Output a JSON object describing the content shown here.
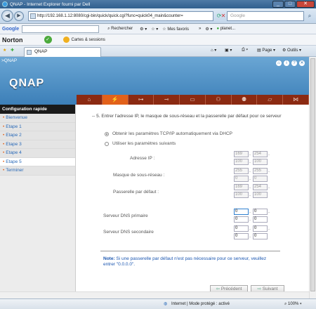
{
  "window": {
    "title": "QNAP - Internet Explorer fourni par Dell"
  },
  "address_bar": {
    "url": "http://192.168.1.12:8080/cgi-bin/quick/quick.cgi?func=quick04_main&counter=",
    "search_placeholder": "Google"
  },
  "google_toolbar": {
    "logo": "Google",
    "search_label": "Rechercher",
    "favorites_label": "Mes favoris",
    "planet_label": "planet..."
  },
  "norton_toolbar": {
    "logo": "Norton",
    "cards_label": "Cartes & sessions"
  },
  "tab_bar": {
    "tab_label": "QNAP",
    "page_label": "Page",
    "tools_label": "Outils"
  },
  "qnap": {
    "breadcrumb": ">QNAP",
    "logo": "QNAP"
  },
  "sidebar": {
    "header": "Configuration rapide",
    "items": [
      {
        "label": "Bienvenue",
        "active": false
      },
      {
        "label": "Etape 1",
        "active": false
      },
      {
        "label": "Etape 2",
        "active": false
      },
      {
        "label": "Etape 3",
        "active": false
      },
      {
        "label": "Etape 4",
        "active": false
      },
      {
        "label": "Etape 5",
        "active": true
      },
      {
        "label": "Terminer",
        "active": false
      }
    ]
  },
  "form": {
    "instruction": "-- 5. Entrer l'adresse IP, le masque de sous-réseau et la passerelle par défaut pour ce serveur",
    "option_dhcp": "Obtenir les paramètres TCP/IP automatiquement via DHCP",
    "option_manual": "Utiliser les paramètres suivants",
    "ip_label": "Adresse IP :",
    "ip_values": [
      "169",
      "254",
      "100",
      "100"
    ],
    "mask_label": "Masque de sous-réseau :",
    "mask_values": [
      "255",
      "255",
      "0",
      "0"
    ],
    "gateway_label": "Passerelle par défaut :",
    "gateway_values": [
      "169",
      "254",
      "100",
      "100"
    ],
    "dns_primary_label": "Serveur DNS primaire",
    "dns_primary_values": [
      "0",
      "0",
      "0",
      "0"
    ],
    "dns_secondary_label": "Serveur DNS secondaire",
    "dns_secondary_values": [
      "0",
      "0",
      "0",
      "0"
    ],
    "note_label": "Note:",
    "note_text": "Si une passerelle par défaut n'est pas nécessaire pour ce serveur, veuillez entrer \"0.0.0.0\".",
    "prev_button": "Précédent",
    "next_button": "Suivant"
  },
  "status_bar": {
    "zone": "Internet | Mode protégé : activé",
    "zoom": "100%"
  }
}
